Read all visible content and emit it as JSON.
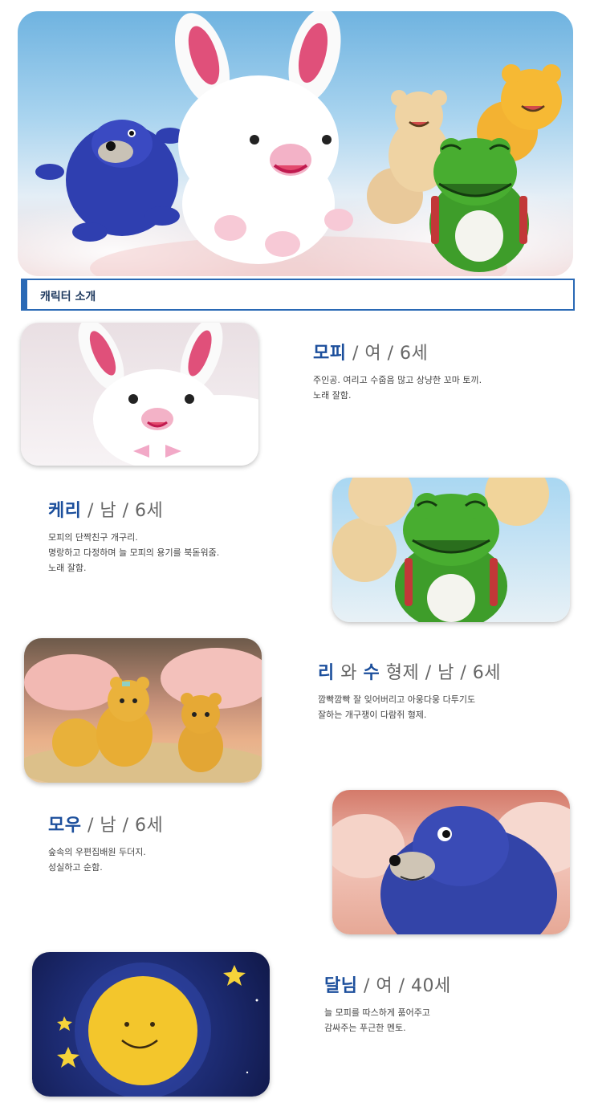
{
  "section": {
    "title": "캐릭터 소개"
  },
  "characters": [
    {
      "name": "모피",
      "rest": " / 여 / 6세",
      "lines": [
        "주인공. 여리고 수줍음 많고 상냥한 꼬마 토끼.",
        "노래 잘함."
      ]
    },
    {
      "name": "케리",
      "rest": " / 남 / 6세",
      "lines": [
        "모피의 단짝친구 개구리.",
        "명랑하고 다정하며 늘 모피의 용기를 북돋워줌.",
        "노래 잘함."
      ]
    },
    {
      "name": "리",
      "mid": " 와 ",
      "name2": "수",
      "rest": " 형제 / 남 / 6세",
      "lines": [
        "깜빡깜빡 잘 잊어버리고 아웅다웅 다투기도",
        "잘하는 개구쟁이 다람쥐 형제."
      ]
    },
    {
      "name": "모우",
      "rest": " / 남 / 6세",
      "lines": [
        "숲속의 우편집배원 두더지.",
        "성실하고 순함."
      ]
    },
    {
      "name": "달님",
      "rest": " / 여 / 40세",
      "lines": [
        "늘 모피를 따스하게 품어주고",
        "감싸주는 푸근한 멘토."
      ]
    }
  ],
  "colors": {
    "accent": "#2a69b5",
    "name": "#1c4f9c"
  }
}
